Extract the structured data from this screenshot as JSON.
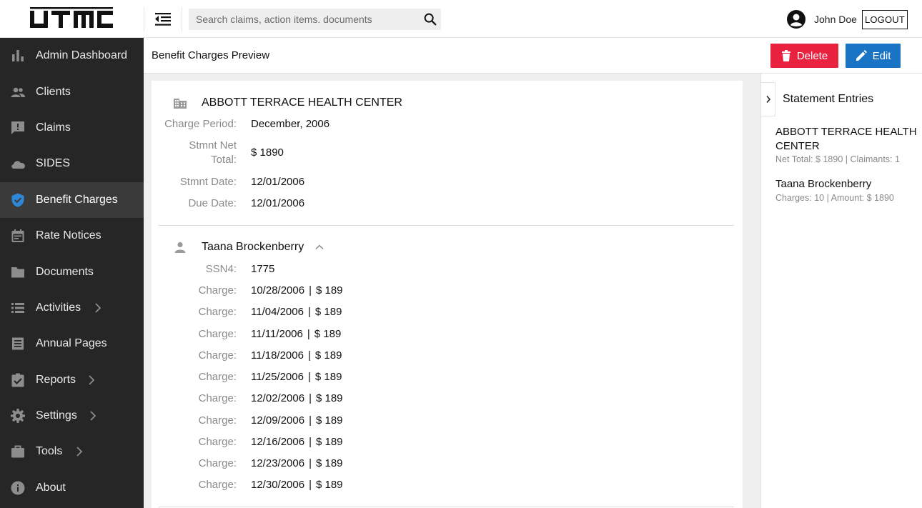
{
  "header": {
    "logo_text": "UTMC",
    "search_placeholder": "Search claims, action items. documents",
    "user_name": "John Doe",
    "logout_label": "LOGOUT"
  },
  "sidebar": {
    "items": [
      {
        "label": "Admin Dashboard",
        "icon": "bar-chart-icon"
      },
      {
        "label": "Clients",
        "icon": "people-icon"
      },
      {
        "label": "Claims",
        "icon": "feedback-icon"
      },
      {
        "label": "SIDES",
        "icon": "cloud-icon"
      },
      {
        "label": "Benefit Charges",
        "icon": "shield-check-icon",
        "active": true
      },
      {
        "label": "Rate Notices",
        "icon": "calendar-icon"
      },
      {
        "label": "Documents",
        "icon": "folder-icon"
      },
      {
        "label": "Activities",
        "icon": "list-icon",
        "has_children": true
      },
      {
        "label": "Annual Pages",
        "icon": "document-list-icon"
      },
      {
        "label": "Reports",
        "icon": "assignment-check-icon",
        "has_children": true
      },
      {
        "label": "Settings",
        "icon": "gear-icon",
        "has_children": true
      },
      {
        "label": "Tools",
        "icon": "briefcase-icon",
        "has_children": true
      },
      {
        "label": "About",
        "icon": "info-icon"
      }
    ]
  },
  "page": {
    "title": "Benefit Charges Preview",
    "delete_label": "Delete",
    "edit_label": "Edit"
  },
  "statement": {
    "org_name": "ABBOTT TERRACE HEALTH CENTER",
    "fields": [
      {
        "label": "Charge Period:",
        "value": "December, 2006"
      },
      {
        "label": "Stmnt Net Total:",
        "value": "$ 1890"
      },
      {
        "label": "Stmnt Date:",
        "value": "12/01/2006"
      },
      {
        "label": "Due Date:",
        "value": "12/01/2006"
      }
    ],
    "claimant": {
      "name": "Taana Brockenberry",
      "ssn_label": "SSN4:",
      "ssn_value": "1775",
      "charge_label": "Charge:",
      "separator": "|",
      "charges": [
        {
          "date": "10/28/2006",
          "amount": "$ 189"
        },
        {
          "date": "11/04/2006",
          "amount": "$ 189"
        },
        {
          "date": "11/11/2006",
          "amount": "$ 189"
        },
        {
          "date": "11/18/2006",
          "amount": "$ 189"
        },
        {
          "date": "11/25/2006",
          "amount": "$ 189"
        },
        {
          "date": "12/02/2006",
          "amount": "$ 189"
        },
        {
          "date": "12/09/2006",
          "amount": "$ 189"
        },
        {
          "date": "12/16/2006",
          "amount": "$ 189"
        },
        {
          "date": "12/23/2006",
          "amount": "$ 189"
        },
        {
          "date": "12/30/2006",
          "amount": "$ 189"
        }
      ]
    }
  },
  "right_panel": {
    "title": "Statement Entries",
    "entries": [
      {
        "title": "ABBOTT TERRACE HEALTH CENTER",
        "meta": "Net Total: $ 1890 | Claimants: 1"
      },
      {
        "title": "Taana Brockenberry",
        "meta": "Charges: 10 | Amount: $ 1890"
      }
    ]
  },
  "colors": {
    "sidebar_bg": "#262626",
    "sidebar_active": "#3a3a3a",
    "active_icon": "#2f87d8",
    "delete": "#e8223f",
    "edit": "#1a74c6"
  }
}
